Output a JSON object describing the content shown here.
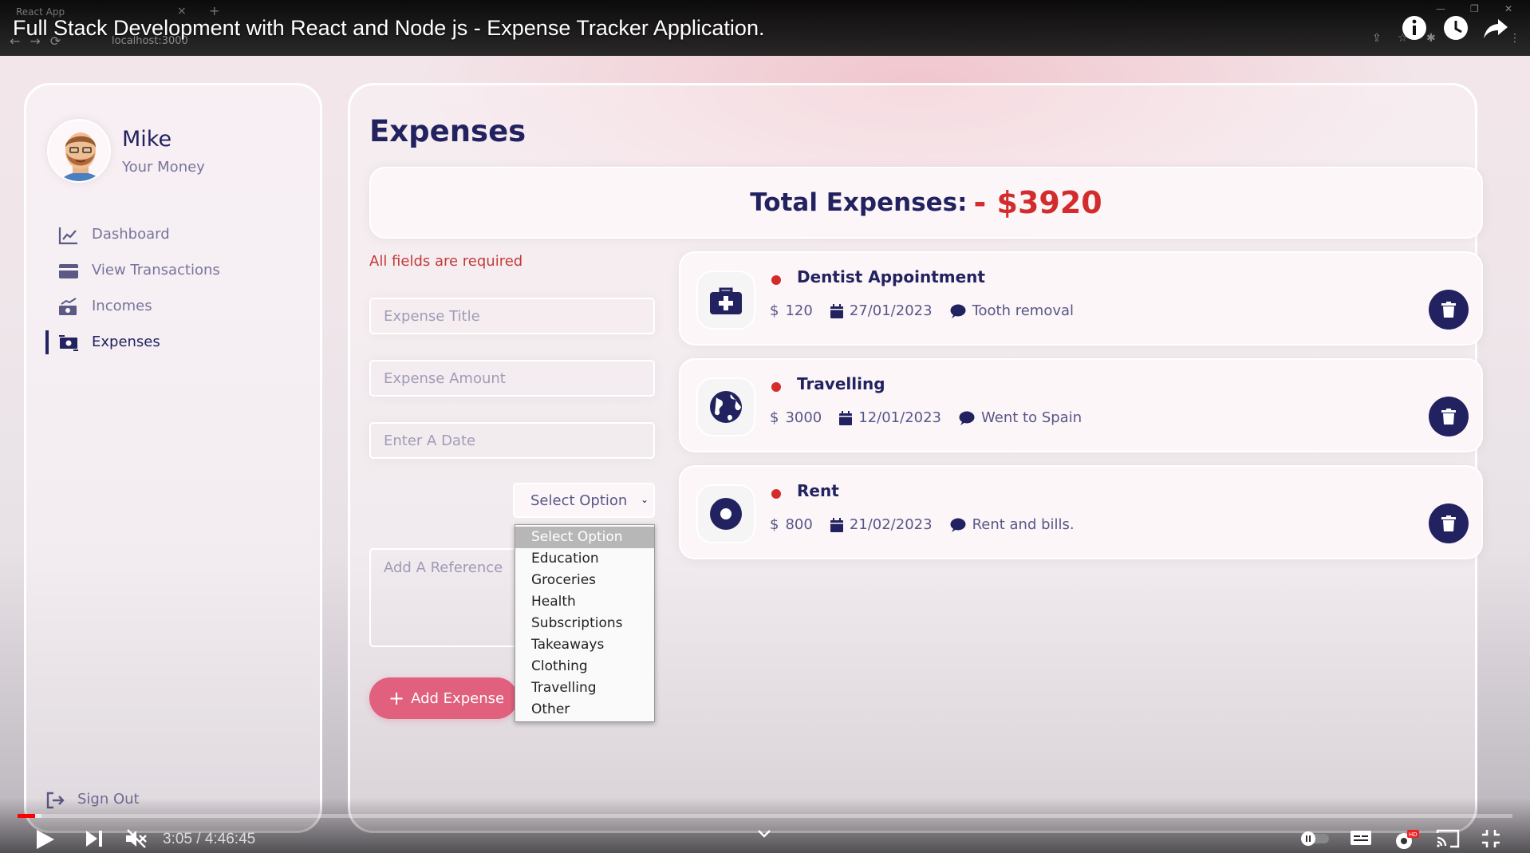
{
  "video": {
    "title": "Full Stack Development with React and Node js - Expense Tracker Application.",
    "time": "3:05 / 4:46:45"
  },
  "browser": {
    "tab_title": "React App",
    "url": "localhost:3000"
  },
  "user": {
    "name": "Mike",
    "subtitle": "Your Money"
  },
  "nav": {
    "items": [
      {
        "label": "Dashboard",
        "icon": "chart-line-icon"
      },
      {
        "label": "View Transactions",
        "icon": "credit-card-icon"
      },
      {
        "label": "Incomes",
        "icon": "money-bill-trend-up-icon"
      },
      {
        "label": "Expenses",
        "icon": "money-bill-transfer-icon",
        "active": true
      }
    ],
    "signout": "Sign Out"
  },
  "page": {
    "title": "Expenses",
    "total_label": "Total Expenses:",
    "total_value": "- $3920"
  },
  "form": {
    "error": "All fields are required",
    "title_placeholder": "Expense Title",
    "amount_placeholder": "Expense Amount",
    "date_placeholder": "Enter A Date",
    "select_value": "Select Option",
    "options": [
      "Select Option",
      "Education",
      "Groceries",
      "Health",
      "Subscriptions",
      "Takeaways",
      "Clothing",
      "Travelling",
      "Other"
    ],
    "reference_placeholder": "Add A Reference",
    "submit_label": "Add Expense"
  },
  "expenses": [
    {
      "title": "Dentist Appointment",
      "amount": "120",
      "date": "27/01/2023",
      "description": "Tooth removal",
      "icon": "medical-kit-icon"
    },
    {
      "title": "Travelling",
      "amount": "3000",
      "date": "12/01/2023",
      "description": "Went to Spain",
      "icon": "globe-icon"
    },
    {
      "title": "Rent",
      "amount": "800",
      "date": "21/02/2023",
      "description": "Rent and bills.",
      "icon": "circle-dot-icon"
    }
  ],
  "colors": {
    "primary": "#222260",
    "accent": "#e0607e",
    "danger": "#d22c2c",
    "youtube_red": "#ff0000"
  }
}
